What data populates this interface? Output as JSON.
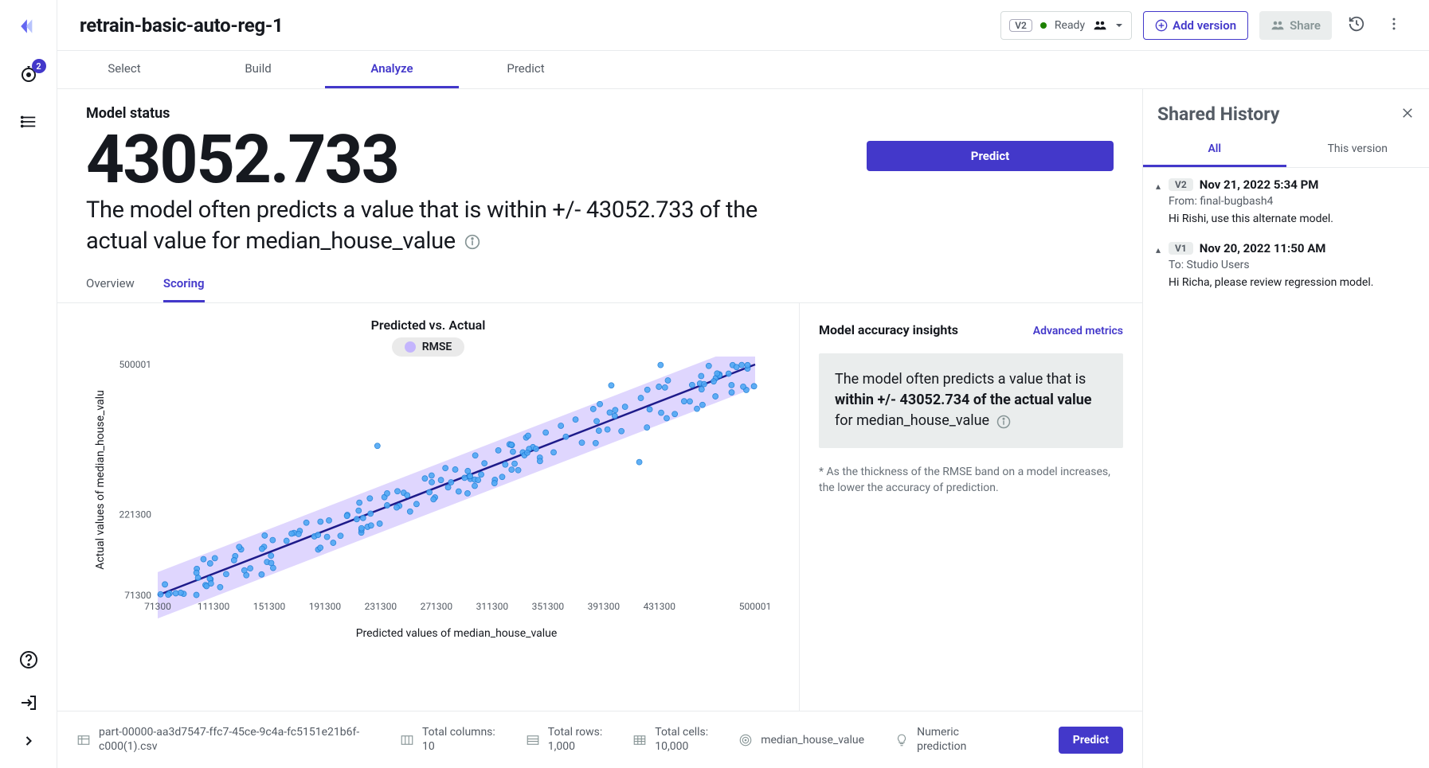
{
  "leftbar": {
    "badge": "2"
  },
  "header": {
    "title": "retrain-basic-auto-reg-1",
    "version_badge": "V2",
    "status": "Ready",
    "add_version": "Add version",
    "share": "Share"
  },
  "tabs": {
    "select": "Select",
    "build": "Build",
    "analyze": "Analyze",
    "predict": "Predict"
  },
  "status": {
    "label": "Model status",
    "value": "43052.733",
    "desc_a": "The model often predicts a value that is within +/- ",
    "desc_b": "43052.733 of the actual value for median_house_value",
    "predict": "Predict"
  },
  "subtabs": {
    "overview": "Overview",
    "scoring": "Scoring"
  },
  "chart": {
    "title": "Predicted vs. Actual",
    "legend": "RMSE",
    "xlabel": "Predicted values of median_house_value",
    "ylabel": "Actual values of median_house_valu"
  },
  "chart_data": {
    "type": "scatter",
    "xlabel": "Predicted values of median_house_value",
    "ylabel": "Actual values of median_house_value",
    "xlim": [
      71300,
      500001
    ],
    "ylim": [
      71300,
      500001
    ],
    "x_ticks": [
      71300,
      111300,
      151300,
      191300,
      231300,
      271300,
      311300,
      351300,
      391300,
      431300,
      500001
    ],
    "y_ticks": [
      71300,
      221300,
      500001
    ],
    "line": {
      "x": [
        71300,
        500001
      ],
      "y": [
        71300,
        500001
      ]
    },
    "rmse_band": 43052.733,
    "title": "Predicted vs. Actual",
    "legend": [
      "RMSE"
    ]
  },
  "insights": {
    "title": "Model accuracy insights",
    "advanced": "Advanced metrics",
    "box_a": "The model often predicts a value that is ",
    "box_bold": "within +/- 43052.734 of the actual value",
    "box_b": " for median_house_value",
    "note": "* As the thickness of the RMSE band on a model increases, the lower the accuracy of prediction."
  },
  "footer": {
    "file": "part-00000-aa3d7547-ffc7-45ce-9c4a-fc5151e21b6f-c000(1).csv",
    "cols_label": "Total columns:",
    "cols_val": "10",
    "rows_label": "Total rows:",
    "rows_val": "1,000",
    "cells_label": "Total cells:",
    "cells_val": "10,000",
    "target": "median_house_value",
    "ptype_label": "Numeric",
    "ptype_val": "prediction",
    "predict": "Predict"
  },
  "history": {
    "title": "Shared History",
    "tab_all": "All",
    "tab_this": "This version",
    "items": [
      {
        "v": "V2",
        "date": "Nov 21, 2022 5:34 PM",
        "meta": "From: final-bugbash4",
        "msg": "Hi Rishi, use this alternate model."
      },
      {
        "v": "V1",
        "date": "Nov 20, 2022 11:50 AM",
        "meta": "To: Studio Users",
        "msg": "Hi Richa, please review regression model."
      }
    ]
  }
}
